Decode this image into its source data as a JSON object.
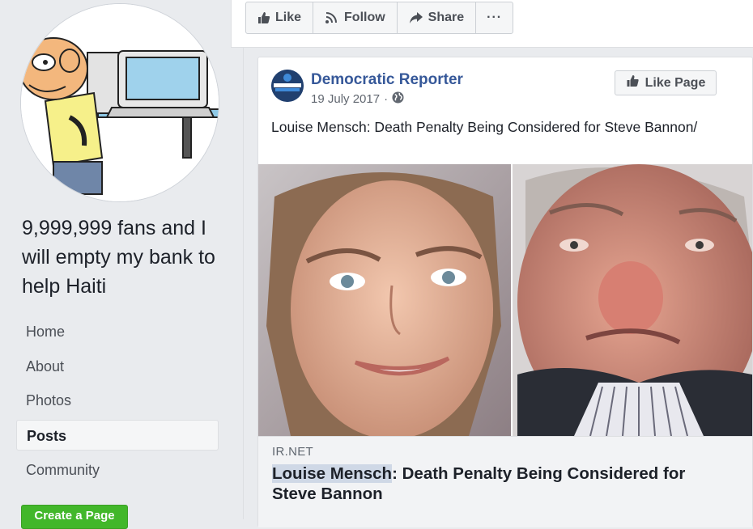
{
  "sidebar": {
    "page_name": "9,999,999 fans and I will empty my bank to help Haiti",
    "nav": [
      {
        "label": "Home"
      },
      {
        "label": "About"
      },
      {
        "label": "Photos"
      },
      {
        "label": "Posts",
        "active": true
      },
      {
        "label": "Community"
      }
    ],
    "create_page_label": "Create a Page"
  },
  "action_bar": {
    "like_label": "Like",
    "follow_label": "Follow",
    "share_label": "Share",
    "more_label": "···"
  },
  "post": {
    "author": "Democratic Reporter",
    "date": "19 July 2017",
    "date_separator": "·",
    "audience_icon": "globe-icon",
    "like_page_label": "Like Page",
    "text": "Louise Mensch: Death Penalty Being Considered for Steve Bannon/",
    "avatar_text": "DEMOCRATIC REPORTER",
    "link": {
      "domain": "IR.NET",
      "title_highlight": "Louise Mensch",
      "title_rest": ": Death Penalty Being Considered for Steve Bannon"
    }
  },
  "colors": {
    "link_blue": "#365899",
    "green_button": "#42b72a",
    "page_bg": "#e9ebee"
  }
}
